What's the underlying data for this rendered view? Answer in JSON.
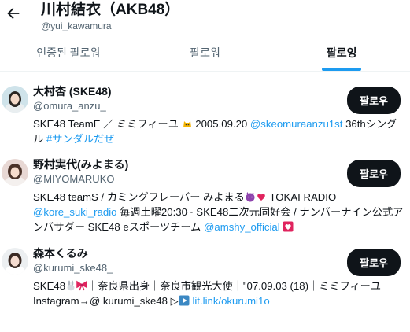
{
  "header": {
    "back_icon": "arrow-left-icon",
    "title": "川村結衣（AKB48）",
    "handle": "@yui_kawamura"
  },
  "tabs": [
    {
      "label": "인증된 팔로워",
      "active": false
    },
    {
      "label": "팔로워",
      "active": false
    },
    {
      "label": "팔로잉",
      "active": true
    }
  ],
  "users": [
    {
      "name": "大村杏 (SKE48)",
      "handle": "@omura_anzu_",
      "button": "팔로우",
      "bio_1": "SKE48 TeamE ／ ミミフィーユ ",
      "bio_emoji_1": "cat-emoji",
      "bio_2": " 2005.09.20 ",
      "bio_link_1": "@skeomuraanzu1st",
      "bio_3": " 36thシングル ",
      "bio_link_2": "#サンダルだぜ"
    },
    {
      "name": "野村実代(みよまる)",
      "handle": "@MIYOMARUKO",
      "button": "팔로우",
      "bio_1": "SKE48 teamS / カミングフレーバー みよまる",
      "bio_emoji_1": "smiling-devil-emoji",
      "bio_emoji_2": "two-hearts-emoji",
      "bio_2": " TOKAI RADIO ",
      "bio_link_1": "@kore_suki_radio",
      "bio_3": " 毎週土曜20:30~ SKE48二次元同好会 / ナンバーナイン公式アンバサダー SKE48 eスポーツチーム ",
      "bio_link_2": "@amshy_official",
      "bio_emoji_3": "heart-emoji"
    },
    {
      "name": "森本くるみ",
      "handle": "@kurumi_ske48_",
      "button": "팔로우",
      "bio_1": "SKE48",
      "bio_emoji_1": "rabbit-emoji",
      "bio_emoji_2": "ribbon-emoji",
      "bio_2": "｜奈良県出身｜奈良市観光大使｜\"07.09.03 (18)｜ミミフィーユ｜Instagram→@ kurumi_ske48 ▷",
      "bio_emoji_3": "play-button-emoji",
      "bio_link_1": " lit.link/okurumi1o"
    }
  ],
  "colors": {
    "accent": "#1d9bf0",
    "text": "#0f1419",
    "muted": "#536471",
    "button_bg": "#0f1419"
  }
}
